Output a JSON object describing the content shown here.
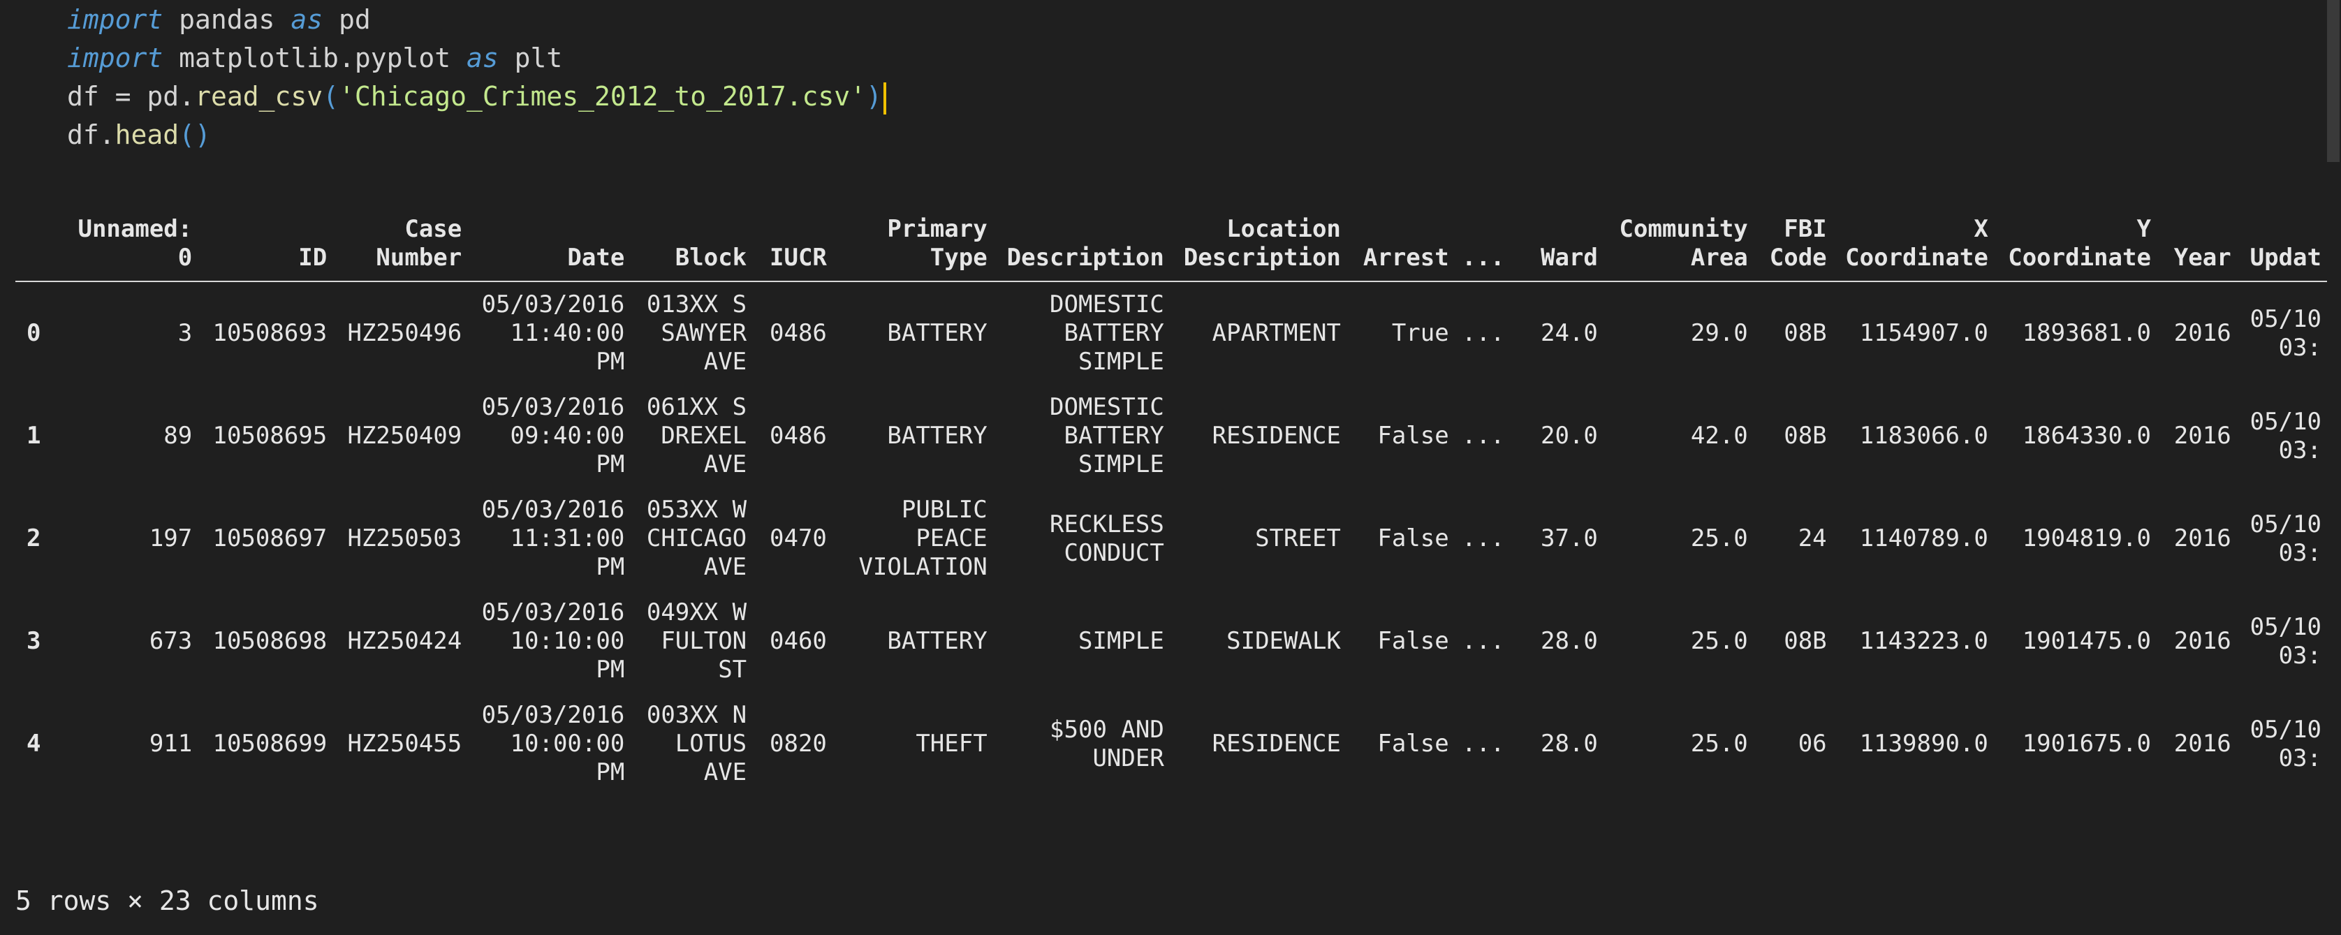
{
  "code": {
    "line1": {
      "kw1": "import",
      "mod": " pandas ",
      "kw2": "as",
      "alias": " pd"
    },
    "line2": {
      "kw1": "import",
      "mod": " matplotlib",
      "dot": ".",
      "sub": "pyplot ",
      "kw2": "as",
      "alias": " plt"
    },
    "line3": {
      "var": "df",
      "eq": " = ",
      "obj": "pd",
      "dot": ".",
      "fn": "read_csv",
      "open": "(",
      "str": "'Chicago_Crimes_2012_to_2017.csv'",
      "close": ")"
    },
    "line4": {
      "var": "df",
      "dot": ".",
      "fn": "head",
      "parens": "()"
    }
  },
  "table": {
    "headers": [
      {
        "l1": "",
        "l2": ""
      },
      {
        "l1": "Unnamed:",
        "l2": "0"
      },
      {
        "l1": "",
        "l2": "ID"
      },
      {
        "l1": "Case",
        "l2": "Number"
      },
      {
        "l1": "",
        "l2": "Date"
      },
      {
        "l1": "",
        "l2": "Block"
      },
      {
        "l1": "",
        "l2": "IUCR"
      },
      {
        "l1": "Primary",
        "l2": "Type"
      },
      {
        "l1": "",
        "l2": "Description"
      },
      {
        "l1": "Location",
        "l2": "Description"
      },
      {
        "l1": "",
        "l2": "Arrest"
      },
      {
        "l1": "",
        "l2": "..."
      },
      {
        "l1": "",
        "l2": "Ward"
      },
      {
        "l1": "Community",
        "l2": "Area"
      },
      {
        "l1": "FBI",
        "l2": "Code"
      },
      {
        "l1": "X",
        "l2": "Coordinate"
      },
      {
        "l1": "Y",
        "l2": "Coordinate"
      },
      {
        "l1": "",
        "l2": "Year"
      },
      {
        "l1": "",
        "l2": "Updat"
      }
    ],
    "rows": [
      {
        "idx": "0",
        "unnamed": "3",
        "id": "10508693",
        "case": "HZ250496",
        "date": [
          "05/03/2016",
          "11:40:00",
          "PM"
        ],
        "block": [
          "013XX S",
          "SAWYER",
          "AVE"
        ],
        "iucr": "0486",
        "ptype": [
          "BATTERY"
        ],
        "desc": [
          "DOMESTIC",
          "BATTERY",
          "SIMPLE"
        ],
        "loc": "APARTMENT",
        "arrest": "True",
        "ellipsis": "...",
        "ward": "24.0",
        "community": "29.0",
        "fbi": "08B",
        "x": "1154907.0",
        "y": "1893681.0",
        "year": "2016",
        "updated": [
          "05/10",
          "03:"
        ]
      },
      {
        "idx": "1",
        "unnamed": "89",
        "id": "10508695",
        "case": "HZ250409",
        "date": [
          "05/03/2016",
          "09:40:00",
          "PM"
        ],
        "block": [
          "061XX S",
          "DREXEL",
          "AVE"
        ],
        "iucr": "0486",
        "ptype": [
          "BATTERY"
        ],
        "desc": [
          "DOMESTIC",
          "BATTERY",
          "SIMPLE"
        ],
        "loc": "RESIDENCE",
        "arrest": "False",
        "ellipsis": "...",
        "ward": "20.0",
        "community": "42.0",
        "fbi": "08B",
        "x": "1183066.0",
        "y": "1864330.0",
        "year": "2016",
        "updated": [
          "05/10",
          "03:"
        ]
      },
      {
        "idx": "2",
        "unnamed": "197",
        "id": "10508697",
        "case": "HZ250503",
        "date": [
          "05/03/2016",
          "11:31:00",
          "PM"
        ],
        "block": [
          "053XX W",
          "CHICAGO",
          "AVE"
        ],
        "iucr": "0470",
        "ptype": [
          "PUBLIC",
          "PEACE",
          "VIOLATION"
        ],
        "desc": [
          "RECKLESS",
          "CONDUCT"
        ],
        "loc": "STREET",
        "arrest": "False",
        "ellipsis": "...",
        "ward": "37.0",
        "community": "25.0",
        "fbi": "24",
        "x": "1140789.0",
        "y": "1904819.0",
        "year": "2016",
        "updated": [
          "05/10",
          "03:"
        ]
      },
      {
        "idx": "3",
        "unnamed": "673",
        "id": "10508698",
        "case": "HZ250424",
        "date": [
          "05/03/2016",
          "10:10:00",
          "PM"
        ],
        "block": [
          "049XX W",
          "FULTON",
          "ST"
        ],
        "iucr": "0460",
        "ptype": [
          "BATTERY"
        ],
        "desc": [
          "SIMPLE"
        ],
        "loc": "SIDEWALK",
        "arrest": "False",
        "ellipsis": "...",
        "ward": "28.0",
        "community": "25.0",
        "fbi": "08B",
        "x": "1143223.0",
        "y": "1901475.0",
        "year": "2016",
        "updated": [
          "05/10",
          "03:"
        ]
      },
      {
        "idx": "4",
        "unnamed": "911",
        "id": "10508699",
        "case": "HZ250455",
        "date": [
          "05/03/2016",
          "10:00:00",
          "PM"
        ],
        "block": [
          "003XX N",
          "LOTUS",
          "AVE"
        ],
        "iucr": "0820",
        "ptype": [
          "THEFT"
        ],
        "desc": [
          "$500 AND",
          "UNDER"
        ],
        "loc": "RESIDENCE",
        "arrest": "False",
        "ellipsis": "...",
        "ward": "28.0",
        "community": "25.0",
        "fbi": "06",
        "x": "1139890.0",
        "y": "1901675.0",
        "year": "2016",
        "updated": [
          "05/10",
          "03:"
        ]
      }
    ],
    "summary": "5 rows × 23 columns"
  }
}
